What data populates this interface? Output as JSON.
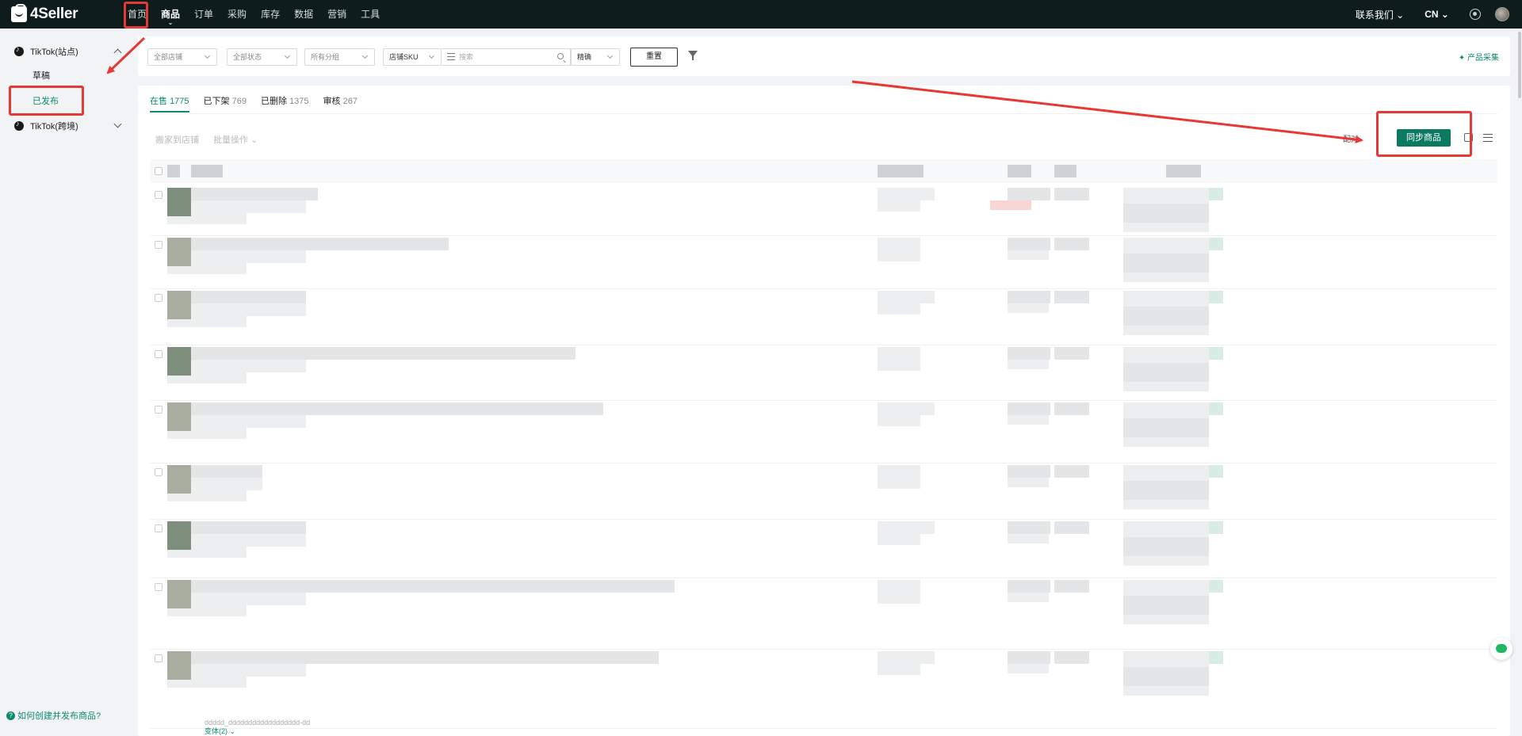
{
  "app": {
    "logo": "4Seller"
  },
  "nav": {
    "items": [
      {
        "label": "首页"
      },
      {
        "label": "商品",
        "active": true
      },
      {
        "label": "订单"
      },
      {
        "label": "采购"
      },
      {
        "label": "库存"
      },
      {
        "label": "数据"
      },
      {
        "label": "营销"
      },
      {
        "label": "工具"
      }
    ],
    "contact": "联系我们 ⌄",
    "lang": "CN ⌄"
  },
  "sidebar": {
    "groups": [
      {
        "label": "TikTok(站点)",
        "expanded": true,
        "items": [
          {
            "label": "草稿"
          },
          {
            "label": "已发布",
            "active": true
          }
        ]
      },
      {
        "label": "TikTok(跨境)",
        "expanded": false
      }
    ],
    "help": "如何创建并发布商品?"
  },
  "filters": {
    "store": "全部店铺",
    "status": "全部状态",
    "group": "所有分组",
    "sku_type": "店铺SKU",
    "search_placeholder": "搜索",
    "match": "精确",
    "reset": "重置",
    "collect": "产品采集"
  },
  "tabs": [
    {
      "label": "在售",
      "count": "1775",
      "active": true
    },
    {
      "label": "已下架",
      "count": "769"
    },
    {
      "label": "已删除",
      "count": "1375"
    },
    {
      "label": "审核",
      "count": "267"
    }
  ],
  "toolbar": {
    "move": "搬家到店铺",
    "batch": "批量操作 ⌄",
    "pair": "配对",
    "sync": "同步商品"
  },
  "footer": {
    "sku_text": "ddddd_dddddddddddddddddd-dd",
    "more_link": "变体(2) ⌄"
  },
  "colors": {
    "brand": "#0b7a61",
    "topbar": "#0e1d1b",
    "annotation": "#e53935"
  }
}
